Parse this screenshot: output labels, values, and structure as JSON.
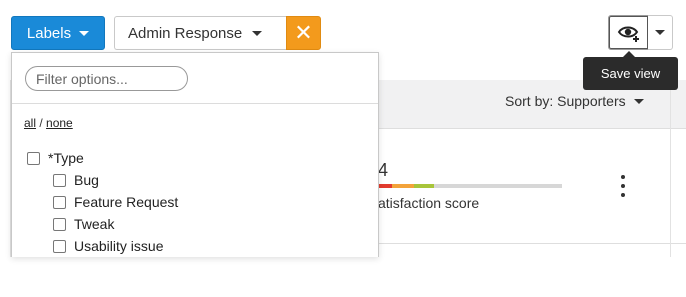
{
  "toolbar": {
    "labels_button": "Labels",
    "filter_chip_label": "Admin Response",
    "filter_remove_glyph": "✕",
    "save_view_tooltip": "Save view",
    "eye_icon": "eye-plus-icon"
  },
  "list": {
    "sort_by": "Sort by: Supporters",
    "satisfaction_number": "4",
    "satisfaction_label": "atisfaction score",
    "satisfaction_colors": [
      "#e23b2e",
      "#f3a33a",
      "#a8c53a",
      "#d7d7d7"
    ]
  },
  "dropdown": {
    "filter_placeholder": "Filter options...",
    "all_link": "all",
    "separator": " / ",
    "none_link": "none",
    "group_label": "*Type",
    "options": [
      "Bug",
      "Feature Request",
      "Tweak",
      "Usability issue"
    ]
  },
  "colors": {
    "primary": "#1a8ad8",
    "accent_orange": "#f39a1c",
    "tooltip_bg": "#2b2b2b"
  }
}
